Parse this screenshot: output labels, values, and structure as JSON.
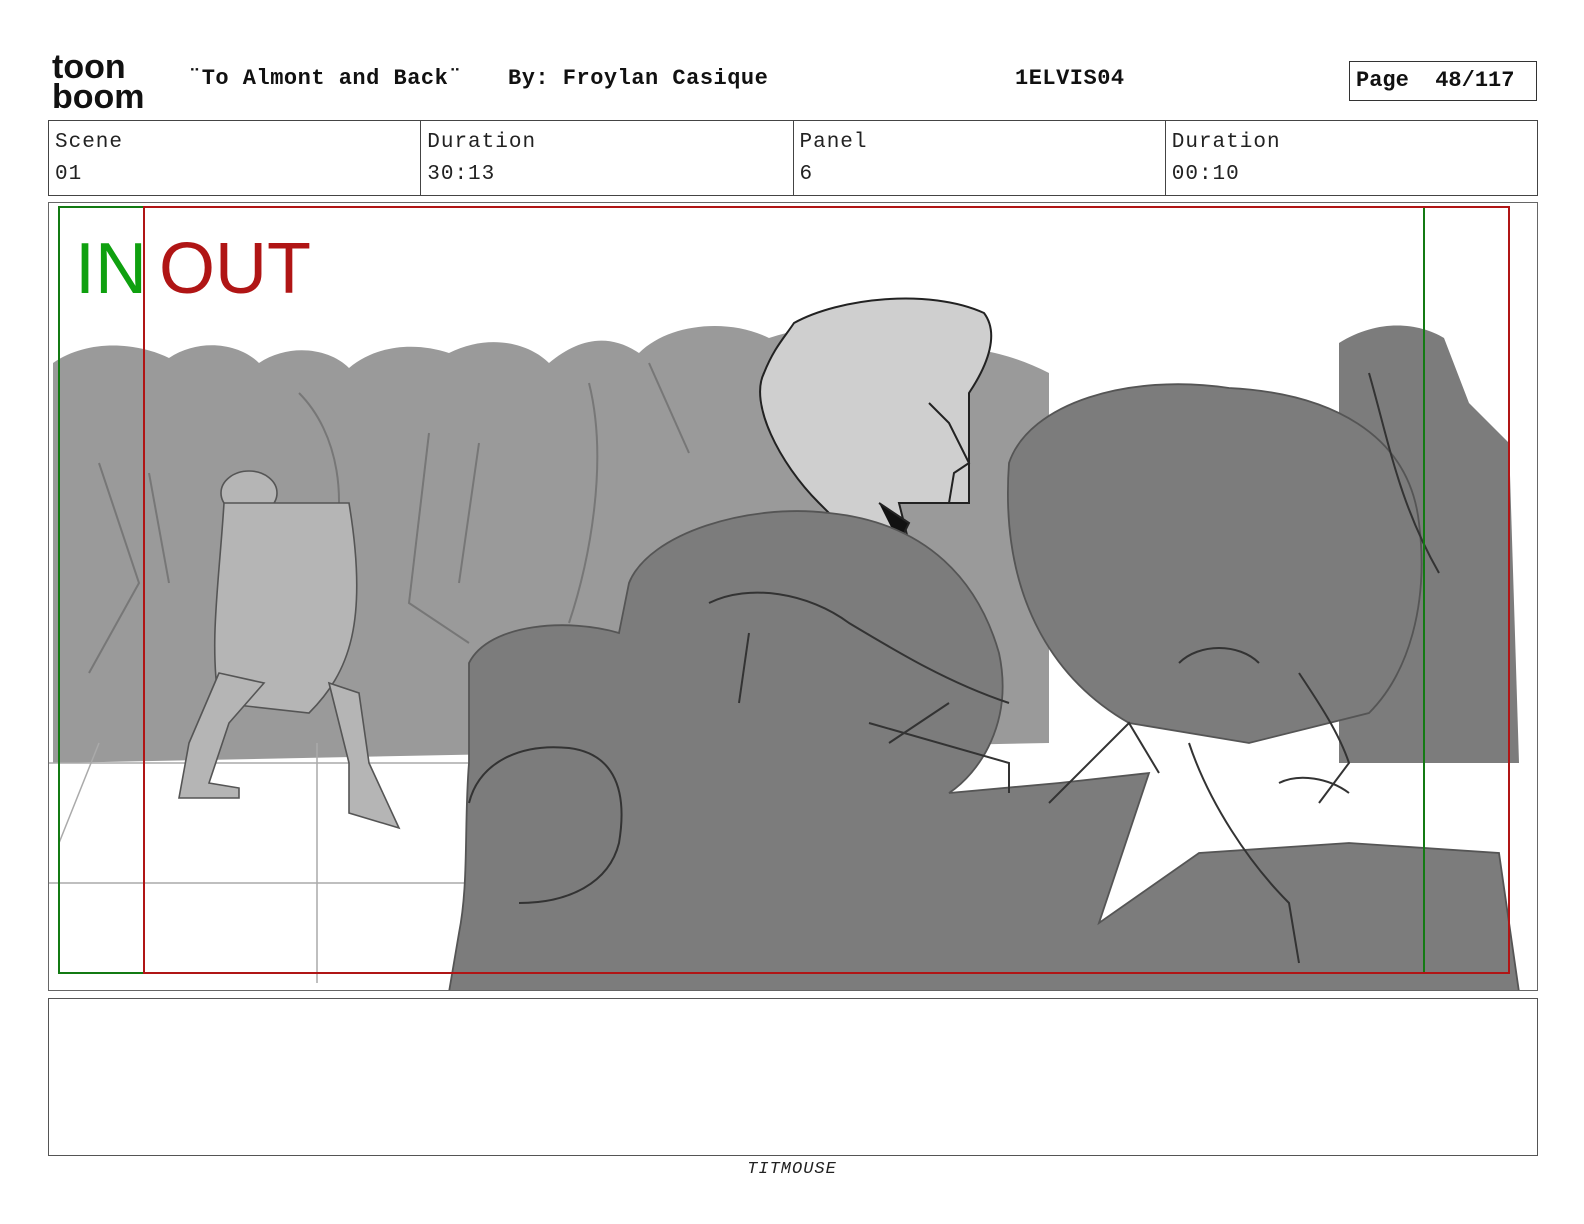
{
  "header": {
    "logo": {
      "top": "toon",
      "bottom": "boom",
      "name": "toon-boom-logo"
    },
    "title": "¨To Almont and Back¨",
    "byline": "By: Froylan Casique",
    "code": "1ELVIS04",
    "page_label": "Page",
    "page_value": "48/117"
  },
  "info": {
    "scene_label": "Scene",
    "scene_value": "01",
    "duration_label": "Duration",
    "duration_value": "30:13",
    "panel_label": "Panel",
    "panel_value": "6",
    "panel_duration_label": "Duration",
    "panel_duration_value": "00:10"
  },
  "panel": {
    "in_label": "IN",
    "out_label": "OUT",
    "colors": {
      "in": "#0fa00f",
      "out": "#b01515",
      "fill_dark": "#7c7c7c",
      "fill_mid": "#9a9a9a",
      "fill_light": "#cfcfcf"
    }
  },
  "footer": {
    "studio": "TITMOUSE"
  }
}
